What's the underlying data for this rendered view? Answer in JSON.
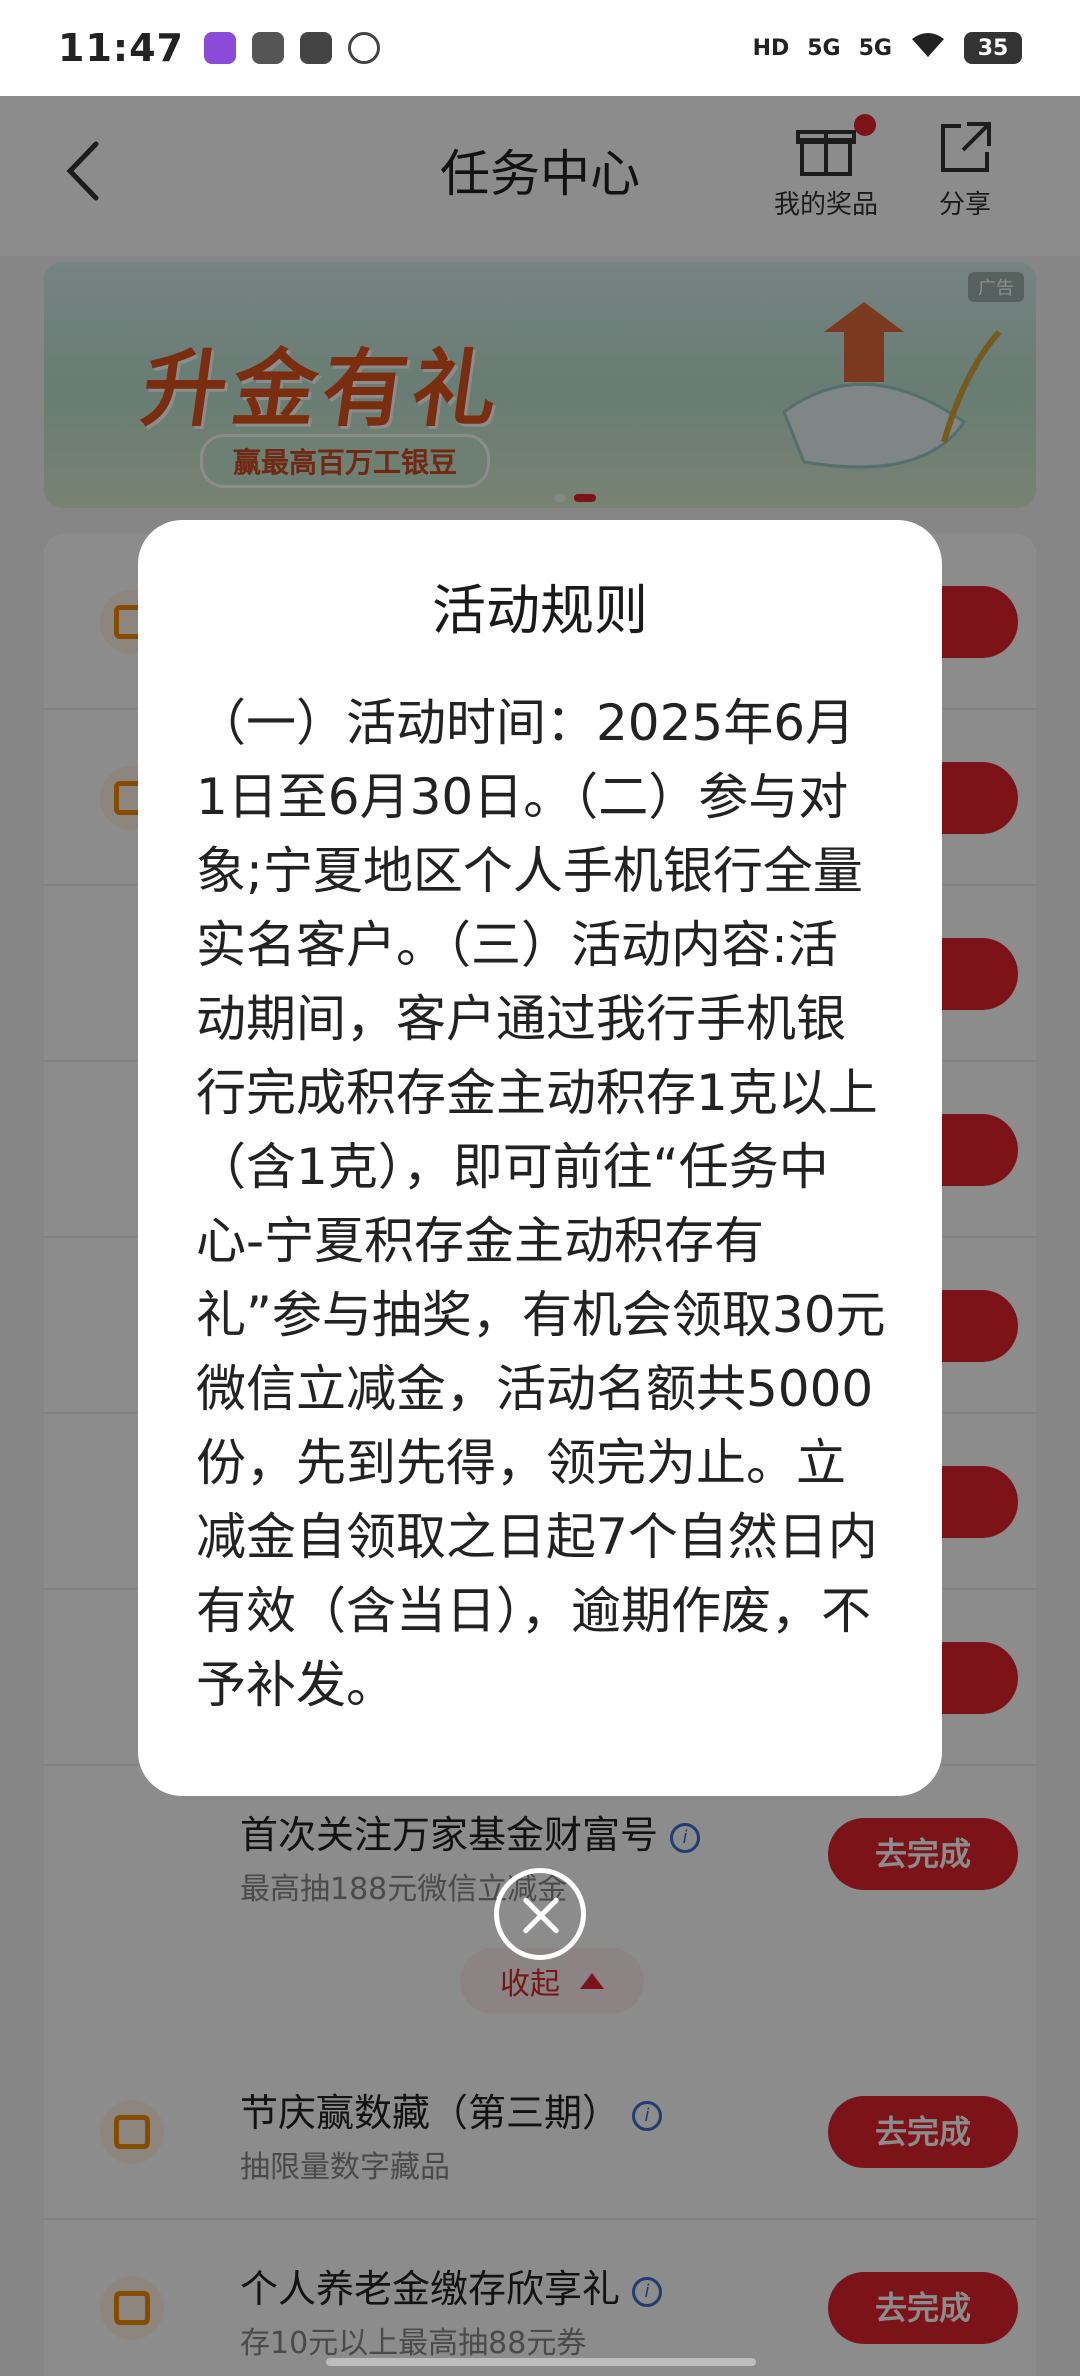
{
  "status_bar": {
    "time": "11:47",
    "network1": "5G",
    "network2": "5G",
    "hd": "HD",
    "battery": "35"
  },
  "header": {
    "title": "任务中心",
    "prizes_label": "我的奖品",
    "share_label": "分享"
  },
  "banner": {
    "ad_tag": "广告",
    "headline": "升金有礼",
    "subline": "赢最高百万工银豆"
  },
  "tasks": [
    {
      "name": "首次关注万家基金财富号",
      "desc": "最高抽188元微信立减金",
      "button": "去完成"
    },
    {
      "name": "节庆赢数藏（第三期）",
      "desc": "抽限量数字藏品",
      "button": "去完成"
    },
    {
      "name": "个人养老金缴存欣享礼",
      "desc": "存10元以上最高抽88元券",
      "button": "去完成"
    }
  ],
  "collapse_label": "收起",
  "partial_buttons": [
    "成",
    "成",
    "成",
    "成",
    "成",
    "成",
    "成"
  ],
  "dialog": {
    "title": "活动规则",
    "body": "（一）活动时间：2025年6月1日至6月30日。（二）参与对象;宁夏地区个人手机银行全量实名客户。（三）活动内容:活动期间，客户通过我行手机银行完成积存金主动积存1克以上（含1克），即可前往“任务中心-宁夏积存金主动积存有礼”参与抽奖，有机会领取30元微信立减金，活动名额共5000份，先到先得，领完为止。立减金自领取之日起7个自然日内有效（含当日），逾期作废，不予补发。"
  }
}
